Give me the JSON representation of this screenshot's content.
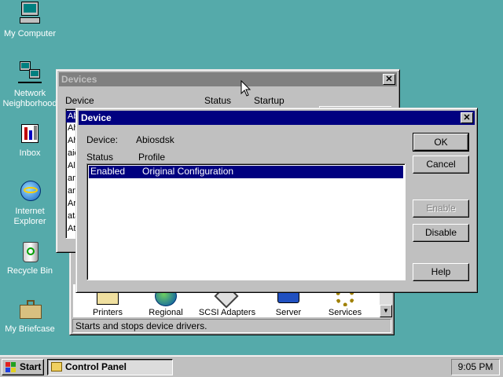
{
  "desktop": {
    "icons": [
      {
        "label": "My Computer",
        "icon": "my-computer-icon"
      },
      {
        "label": "Network Neighborhood",
        "icon": "network-neighborhood-icon"
      },
      {
        "label": "Inbox",
        "icon": "inbox-icon"
      },
      {
        "label": "Internet Explorer",
        "icon": "internet-explorer-icon"
      },
      {
        "label": "Recycle Bin",
        "icon": "recycle-bin-icon"
      },
      {
        "label": "My Briefcase",
        "icon": "briefcase-icon"
      }
    ]
  },
  "control_panel": {
    "items": [
      "Printers",
      "Regional",
      "SCSI Adapters",
      "Server",
      "Services"
    ],
    "status_text": "Starts and stops device drivers."
  },
  "devices_window": {
    "title": "Devices",
    "columns": [
      "Device",
      "Status",
      "Startup"
    ],
    "rows": [
      "Abi",
      "Ah",
      "Ah",
      "aic",
      "Al",
      "am",
      "an",
      "Ar",
      "ata",
      "Ati"
    ]
  },
  "device_dialog": {
    "title": "Device",
    "device_label": "Device:",
    "device_value": "Abiosdsk",
    "status_header": "Status",
    "profile_header": "Profile",
    "profiles": [
      {
        "status": "Enabled",
        "profile": "Original Configuration"
      }
    ],
    "buttons": {
      "ok": "OK",
      "cancel": "Cancel",
      "enable": "Enable",
      "disable": "Disable",
      "help": "Help"
    }
  },
  "taskbar": {
    "start_label": "Start",
    "task_label": "Control Panel",
    "clock": "9:05 PM"
  },
  "colors": {
    "desktop": "#55aaaa",
    "active_title": "#000080",
    "inactive_title": "#808080",
    "face": "#c0c0c0"
  }
}
